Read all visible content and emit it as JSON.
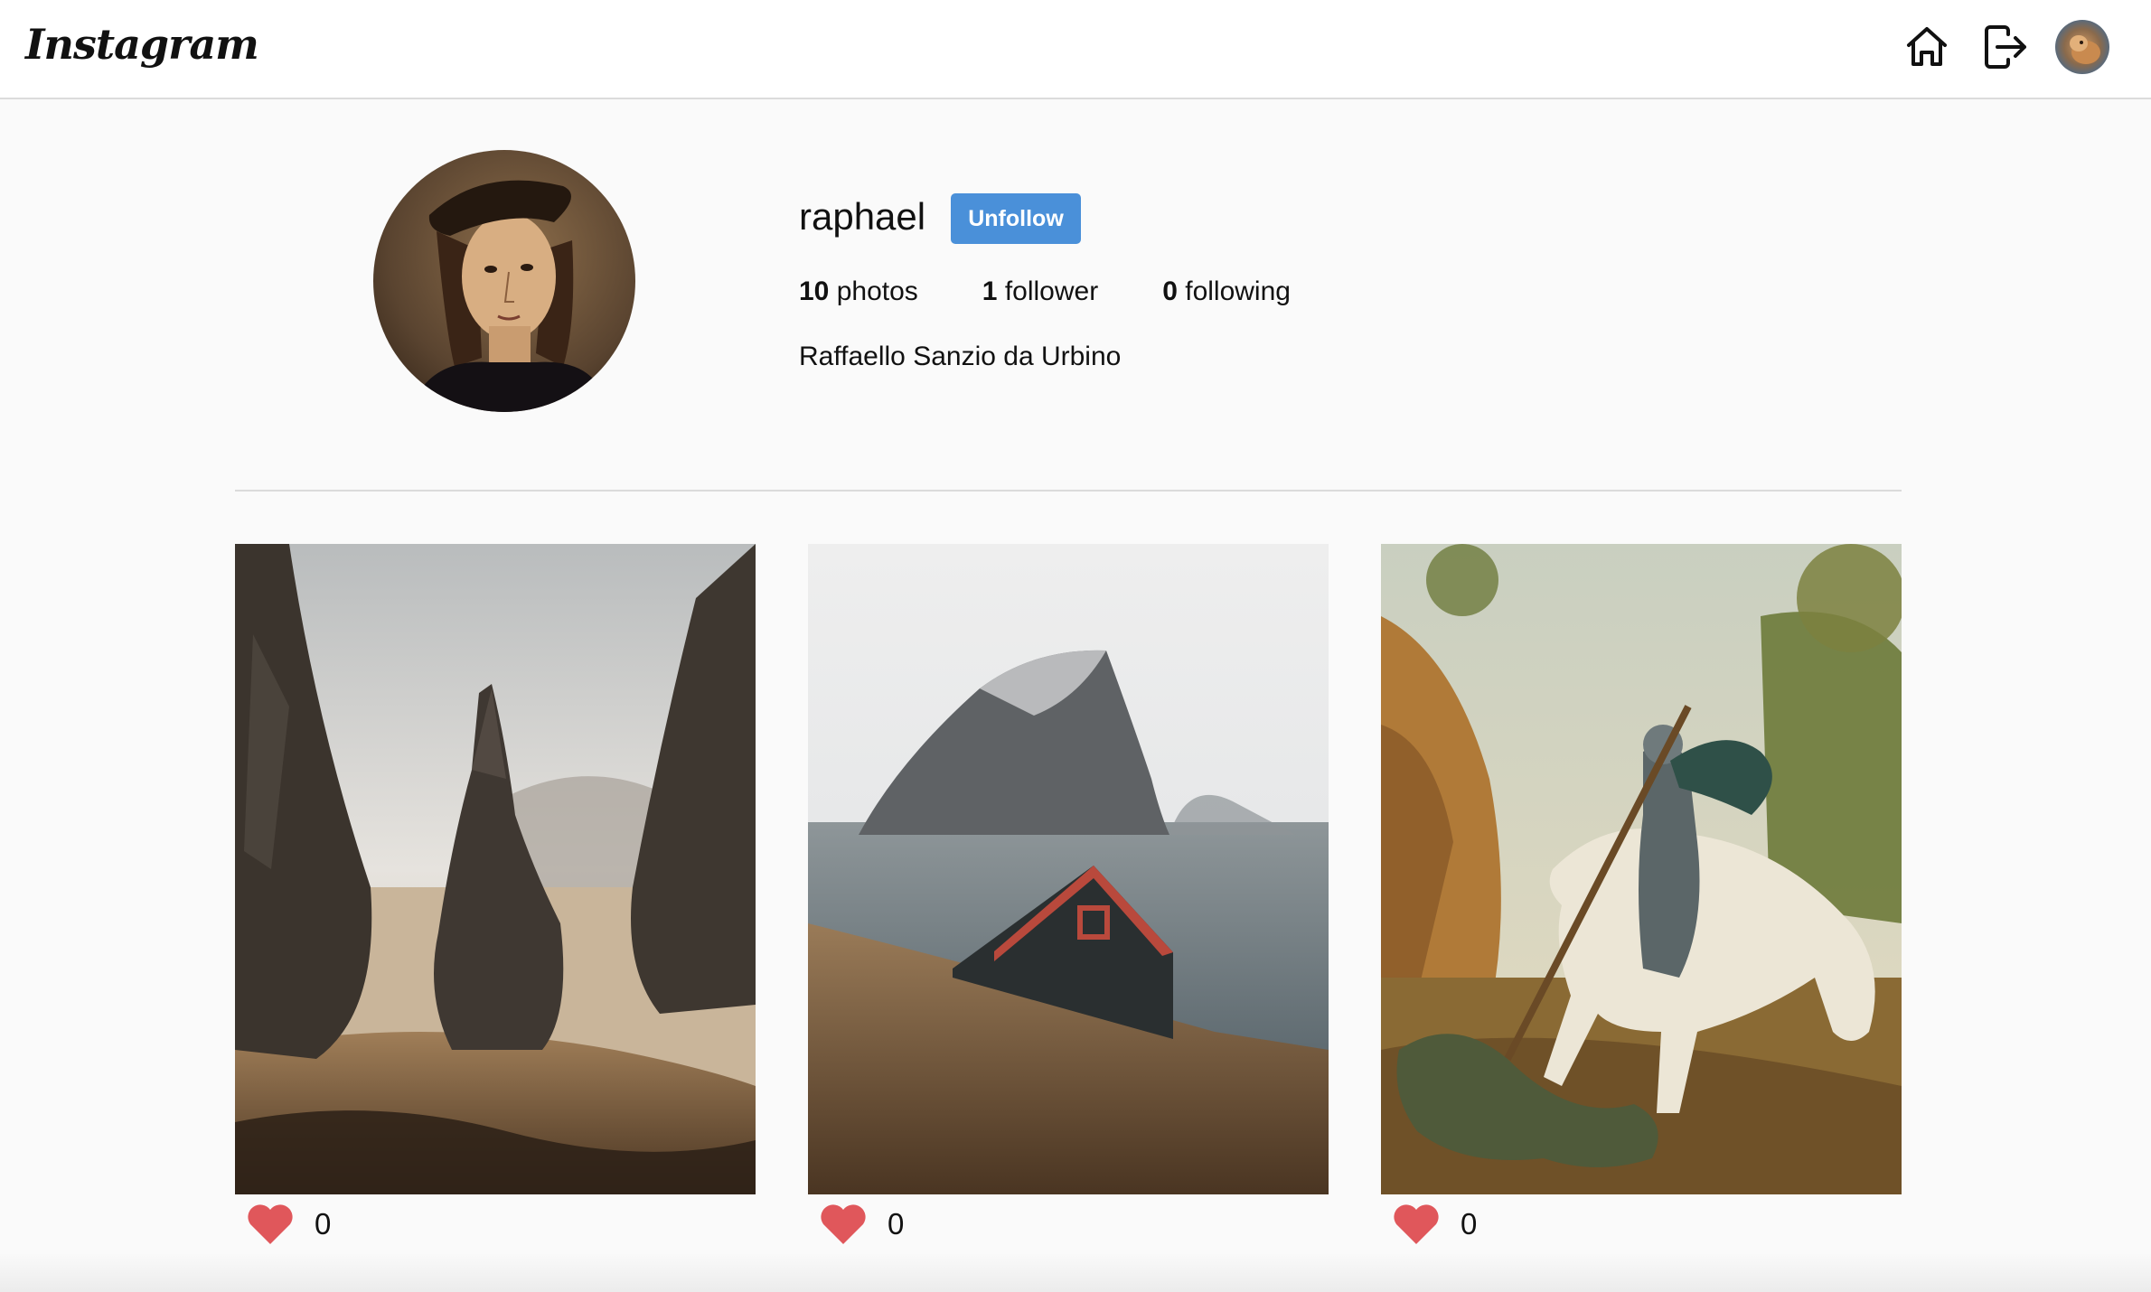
{
  "header": {
    "logo_text": "Instagram",
    "icons": [
      "home-icon",
      "logout-icon",
      "user-avatar"
    ]
  },
  "profile": {
    "username": "raphael",
    "follow_button_label": "Unfollow",
    "stats": {
      "photos_count": "10",
      "photos_label": "photos",
      "followers_count": "1",
      "followers_label": "follower",
      "following_count": "0",
      "following_label": "following"
    },
    "full_name": "Raffaello Sanzio da Urbino"
  },
  "posts": [
    {
      "likes": "0",
      "image": "rocky-spires-landscape-photo"
    },
    {
      "likes": "0",
      "image": "island-and-dark-house-photo"
    },
    {
      "likes": "0",
      "image": "knight-slaying-dragon-painting"
    }
  ],
  "colors": {
    "accent": "#4a90d9",
    "heart": "#e0575b",
    "background": "#fafafa",
    "border": "#dbdbdb"
  }
}
